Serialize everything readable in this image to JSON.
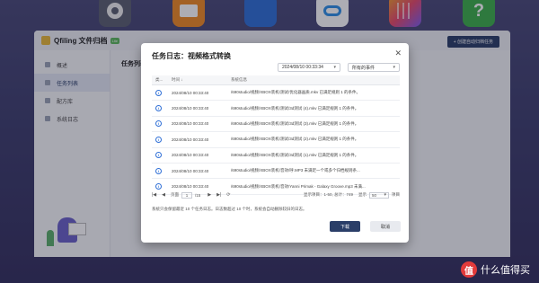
{
  "app": {
    "title": "Qfiling 文件归档",
    "badge": "Lite",
    "create_button": "+ 创建自动归档任务",
    "main_title": "任务列表"
  },
  "sidebar": {
    "items": [
      {
        "label": "概述"
      },
      {
        "label": "任务列表"
      },
      {
        "label": "配方库"
      },
      {
        "label": "系统日志"
      }
    ]
  },
  "dialog": {
    "title": "任务日志：视频格式转换",
    "close_icon": "close-icon",
    "date_filter": "2024/08/10 00:33:34",
    "event_filter": "所有的事件",
    "columns": {
      "type": "类...",
      "time": "时间",
      "message": "系统信息"
    },
    "rows": [
      {
        "time": "2024/08/10 00:33:40",
        "message": "/690studio/视频/XBOX装机/测试/优化器画质.mkv 已满足规则 1 的条件。"
      },
      {
        "time": "2024/08/10 00:33:40",
        "message": "/690studio/视频/XBOX装机/测试/3d测试 (4).mkv 已满足规则 1 的条件。"
      },
      {
        "time": "2024/08/10 00:33:40",
        "message": "/690studio/视频/XBOX装机/测试/3d测试 (3).mkv 已满足规则 1 的条件。"
      },
      {
        "time": "2024/08/10 00:33:40",
        "message": "/690studio/视频/XBOX装机/测试/3d测试 (2).mkv 已满足规则 1 的条件。"
      },
      {
        "time": "2024/08/10 00:33:40",
        "message": "/690studio/视频/XBOX装机/测试/3d测试 (1).mkv 已满足规则 1 的条件。"
      },
      {
        "time": "2024/08/10 00:33:40",
        "message": "/690studio/视频/XBOX装机/音效/呼.MP3 未满足一个或多个归档规则条..."
      },
      {
        "time": "2024/08/10 00:33:40",
        "message": "/690studio/视频/XBOX装机/音效/Yanni Primak - Galaxy Groove.mp3 未满..."
      }
    ],
    "pager": {
      "page_label": "页面",
      "page_value": "1",
      "total_pages": "/15",
      "display_info": "显示项目：1-50, 总计：749",
      "per_page_label": "显示",
      "per_page_value": "50",
      "unit": "项目"
    },
    "note": "系统只会保留最近 10 个任务日志。日志数超过 10 个时，系统会自动删除较旧的日志。",
    "download_button": "下载",
    "cancel_button": "取消"
  },
  "watermark": {
    "logo_char": "值",
    "text": "什么值得买"
  }
}
